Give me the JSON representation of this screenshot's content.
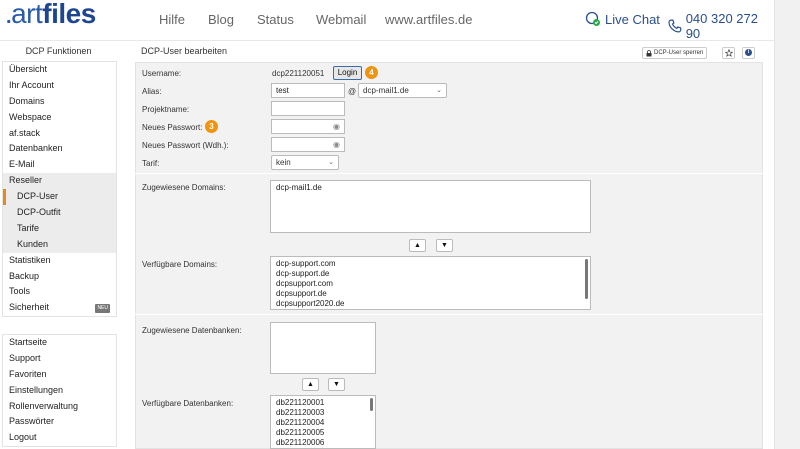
{
  "header": {
    "logo_prefix": ".",
    "logo_art": "art",
    "logo_files": "files",
    "nav": [
      "Hilfe",
      "Blog",
      "Status",
      "Webmail",
      "www.artfiles.de"
    ],
    "live_chat": "Live Chat",
    "phone": "040 320 272 90"
  },
  "sidebar": {
    "title": "DCP Funktionen",
    "items": [
      {
        "label": "Übersicht"
      },
      {
        "label": "Ihr Account"
      },
      {
        "label": "Domains"
      },
      {
        "label": "Webspace"
      },
      {
        "label": "af.stack"
      },
      {
        "label": "Datenbanken"
      },
      {
        "label": "E-Mail"
      },
      {
        "label": "Reseller"
      },
      {
        "label": "DCP-User"
      },
      {
        "label": "DCP-Outfit"
      },
      {
        "label": "Tarife"
      },
      {
        "label": "Kunden"
      },
      {
        "label": "Statistiken"
      },
      {
        "label": "Backup"
      },
      {
        "label": "Tools"
      },
      {
        "label": "Sicherheit"
      }
    ],
    "neu_badge": "NEU",
    "items2": [
      {
        "label": "Startseite"
      },
      {
        "label": "Support"
      },
      {
        "label": "Favoriten"
      },
      {
        "label": "Einstellungen"
      },
      {
        "label": "Rollenverwaltung"
      },
      {
        "label": "Passwörter"
      },
      {
        "label": "Logout"
      }
    ]
  },
  "panel": {
    "title": "DCP-User bearbeiten",
    "sperren_label": "DCP-User sperren",
    "star_icon": "star-icon",
    "info_icon": "info-icon",
    "info_glyph": "i"
  },
  "form": {
    "username_label": "Username:",
    "username_value": "dcp221120051",
    "login_label": "Login",
    "badge_login": "4",
    "alias_label": "Alias:",
    "alias_value": "test",
    "at": "@",
    "alias_domain": "dcp-mail1.de",
    "projektname_label": "Projektname:",
    "projektname_value": "",
    "passwort_label": "Neues Passwort:",
    "badge_pw": "3",
    "passwort_wdh_label": "Neues Passwort (Wdh.):",
    "tarif_label": "Tarif:",
    "tarif_value": "kein",
    "assigned_domains_label": "Zugewiesene Domains:",
    "assigned_domains": [
      "dcp-mail1.de"
    ],
    "available_domains_label": "Verfügbare Domains:",
    "available_domains": [
      "dcp-support.com",
      "dcp-support.de",
      "dcpsupport.com",
      "dcpsupport.de",
      "dcpsupport2020.de"
    ],
    "assigned_db_label": "Zugewiesene Datenbanken:",
    "assigned_dbs": [],
    "available_db_label": "Verfügbare Datenbanken:",
    "available_dbs": [
      "db221120001",
      "db221120003",
      "db221120004",
      "db221120005",
      "db221120006"
    ],
    "up_arrow": "▲",
    "down_arrow": "▼"
  },
  "colors": {
    "brand": "#2a5aa8",
    "accent": "#e38b1c",
    "badge": "#f0940f"
  }
}
